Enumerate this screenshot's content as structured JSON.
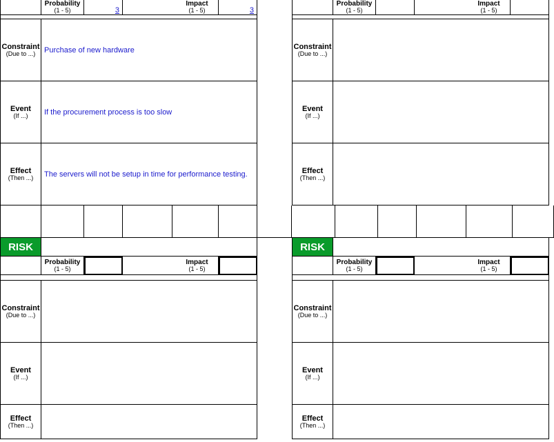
{
  "labels": {
    "risk": "RISK",
    "probability": "Probability",
    "impact": "Impact",
    "range": "(1 - 5)",
    "constraint": "Constraint",
    "constraint_sub": "(Due to ...)",
    "event": "Event",
    "event_sub": "(If ...)",
    "effect": "Effect",
    "effect_sub": "(Then ...)"
  },
  "cards": [
    {
      "probability": "3",
      "impact": "3",
      "constraint": "Purchase of new hardware",
      "event": "If the procurement process is too slow",
      "effect": "The servers will not be setup in time for performance testing."
    },
    {
      "probability": "",
      "impact": "",
      "constraint": "",
      "event": "",
      "effect": ""
    },
    {
      "probability": "",
      "impact": "",
      "constraint": "",
      "event": "",
      "effect": ""
    },
    {
      "probability": "",
      "impact": "",
      "constraint": "",
      "event": "",
      "effect": ""
    }
  ]
}
